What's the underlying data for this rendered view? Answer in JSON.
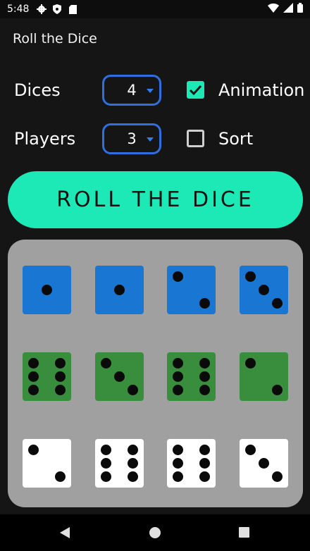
{
  "status_bar": {
    "time": "5:48"
  },
  "app_title": "Roll the Dice",
  "settings": {
    "dices_label": "Dices",
    "dices_value": "4",
    "players_label": "Players",
    "players_value": "3",
    "animation_label": "Animation",
    "animation_checked": true,
    "sort_label": "Sort",
    "sort_checked": false
  },
  "roll_button_label": "ROLL THE DICE",
  "colors": {
    "accent": "#1de9b6",
    "player1": "#1976d2",
    "player2": "#388e3c",
    "player3": "#ffffff",
    "spinner_border": "#2f6fe0"
  },
  "dice_rows": [
    {
      "player": 1,
      "color": "blue",
      "values": [
        1,
        1,
        2,
        3
      ]
    },
    {
      "player": 2,
      "color": "green",
      "values": [
        6,
        3,
        6,
        2
      ]
    },
    {
      "player": 3,
      "color": "white",
      "values": [
        2,
        6,
        6,
        3
      ]
    }
  ]
}
